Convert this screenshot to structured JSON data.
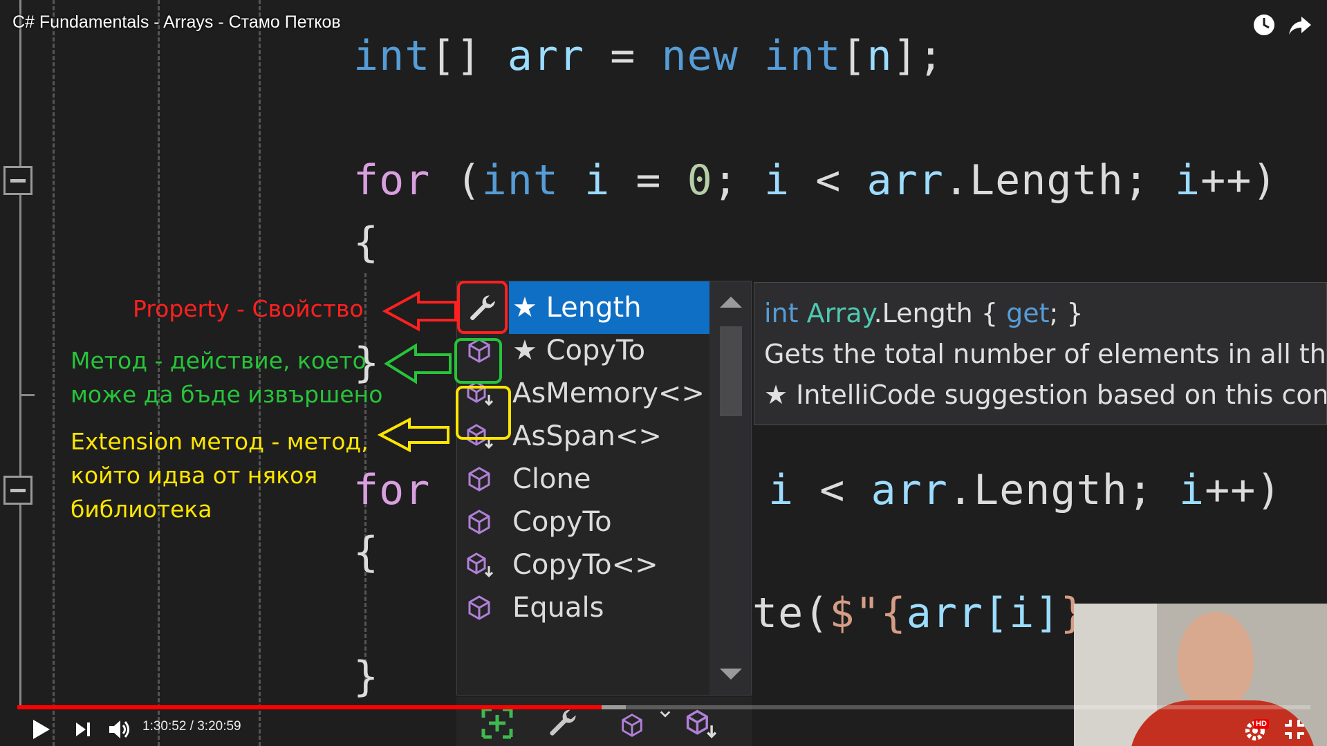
{
  "player": {
    "title": "C# Fundamentals - Arrays - Стамо Петков",
    "time": "1:30:52 / 3:20:59",
    "progress_fraction": 0.452,
    "icons": [
      "clock-icon",
      "share-icon",
      "play-icon",
      "next-icon",
      "volume-icon",
      "settings-icon",
      "exit-fullscreen-icon"
    ],
    "hd_badge": "HD"
  },
  "code": {
    "line1": {
      "kw1": "int",
      "p1": "[] ",
      "var1": "arr",
      "p2": " = ",
      "kw2": "new",
      "p3": " ",
      "kw3": "int",
      "p4": "[",
      "var2": "n",
      "p5": "];"
    },
    "line2": {
      "ctl": "for",
      "p1": " (",
      "kw": "int",
      "p2": " ",
      "var1": "i",
      "p3": " = ",
      "num": "0",
      "p4": "; ",
      "var2": "i",
      "p5": " < ",
      "var3": "arr",
      "p6": ".Length; ",
      "var4": "i",
      "p7": "++)"
    },
    "brace_open": "{",
    "brace_close_left": "}",
    "line_for2": "for",
    "line_for2_rest": {
      "var1": "i",
      "p1": " < ",
      "var2": "arr",
      "p2": ".Length; ",
      "var3": "i",
      "p3": "++)"
    },
    "brace_open2": "{",
    "line_write": {
      "p1": "te(",
      "str": "$\"{",
      "var": "arr[i]",
      "str2": "}"
    },
    "brace_close2": "}"
  },
  "completion": {
    "items": [
      {
        "label": "★ Length",
        "icon": "property-wrench-icon",
        "selected": true
      },
      {
        "label": "★ CopyTo",
        "icon": "method-cube-icon",
        "selected": false
      },
      {
        "label": "AsMemory<>",
        "icon": "extension-method-icon",
        "selected": false
      },
      {
        "label": "AsSpan<>",
        "icon": "extension-method-icon",
        "selected": false
      },
      {
        "label": "Clone",
        "icon": "method-cube-icon",
        "selected": false
      },
      {
        "label": "CopyTo",
        "icon": "method-cube-icon",
        "selected": false
      },
      {
        "label": "CopyTo<>",
        "icon": "extension-method-icon",
        "selected": false
      },
      {
        "label": "Equals",
        "icon": "method-cube-icon",
        "selected": false
      }
    ],
    "filters": [
      "add-filter-icon",
      "wrench-filter-icon",
      "cube-filter-icon",
      "chevron-down-icon",
      "extension-filter-icon"
    ]
  },
  "tooltip": {
    "sig_kw": "int",
    "sig_type": "Array",
    "sig_member": ".Length",
    "sig_accessor_open": " { ",
    "sig_get": "get",
    "sig_accessor_close": "; }",
    "description": "Gets the total number of elements in all the",
    "intellicode": "★  IntelliCode suggestion based on this con"
  },
  "annotations": {
    "property": "Property - Свойство",
    "method_line1": "Метод - действие, което",
    "method_line2": "може да бъде извършено",
    "extension_line1": "Extension метод - метод,",
    "extension_line2": "който идва от някоя",
    "extension_line3": "библиотека",
    "colors": {
      "red": "#ff2020",
      "green": "#27c43a",
      "yellow": "#ffe600"
    }
  }
}
